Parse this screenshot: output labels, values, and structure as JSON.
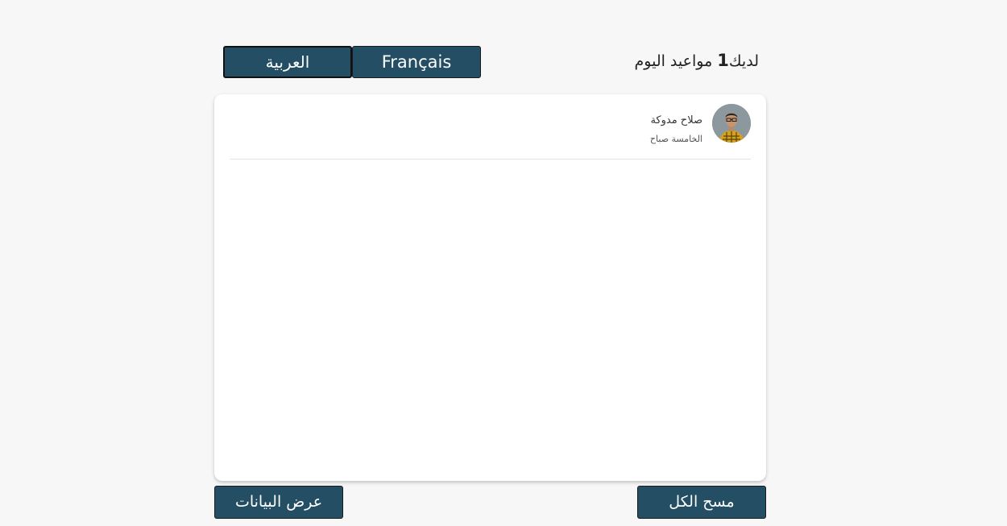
{
  "language_switch": {
    "arabic_label": "العربية",
    "french_label": "Français"
  },
  "header": {
    "prefix": "لديك",
    "count": "1",
    "suffix": " مواعيد اليوم"
  },
  "appointments": [
    {
      "name": "صلاح مدوكة",
      "time": "الخامسة صباح",
      "avatar": "person-photo"
    }
  ],
  "footer": {
    "show_data_label": "عرض البيانات",
    "clear_all_label": "مسح الكل"
  },
  "colors": {
    "button_bg": "#234e63",
    "page_bg": "#f7f7f7"
  }
}
